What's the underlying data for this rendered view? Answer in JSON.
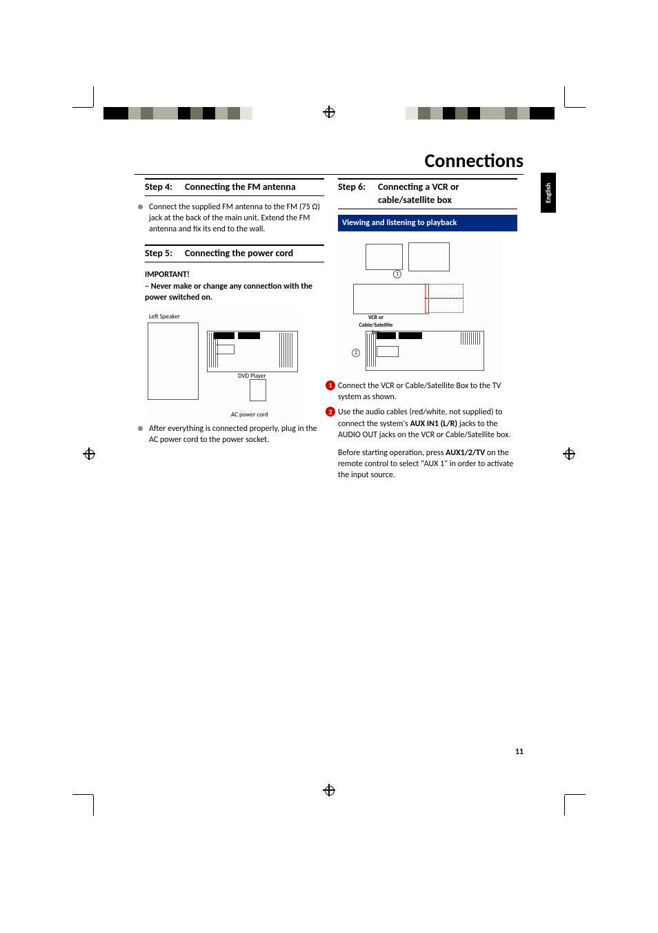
{
  "title": "Connections",
  "language_tab": "English",
  "page_number": "11",
  "left": {
    "step4": {
      "label": "Step 4:",
      "title": "Connecting the FM antenna"
    },
    "step4_body": "Connect the supplied FM antenna to the FM (75 Ω) jack at the back of the main unit. Extend the FM antenna and fix its end to the wall.",
    "step5": {
      "label": "Step 5:",
      "title": "Connecting the power cord"
    },
    "important_head": "IMPORTANT!",
    "important_body": "–   Never make or change any connection with the power switched on.",
    "diag": {
      "left_speaker": "Left Speaker",
      "dvd_player": "DVD Player",
      "ac_cord": "AC power cord"
    },
    "after_text": "After everything is connected properly, plug in the AC power cord to the power socket."
  },
  "right": {
    "step6": {
      "label": "Step 6:",
      "title": "Connecting a VCR or cable/satellite box"
    },
    "blue": "Viewing and listening to playback",
    "diag": {
      "vcr_label": "VCR or Cable/Satellite Box",
      "c1": "1",
      "c2": "2"
    },
    "n1": "Connect the VCR or Cable/Satellite Box to the TV system as shown.",
    "n2_pre": "Use the audio cables (red/white, not supplied) to connect the system's ",
    "n2_bold": "AUX IN1 (L/R)",
    "n2_post": " jacks to the AUDIO OUT jacks on the VCR or Cable/Satellite box.",
    "final_pre": "Before starting operation, press ",
    "final_bold": "AUX1/2/TV",
    "final_post": " on the remote control to select \"AUX 1\" in order to activate the input source."
  },
  "strip_colors": [
    "#000000",
    "#000000",
    "#b0b0a0",
    "#707060",
    "#b0b0a0",
    "#b0b0a0",
    "#000000",
    "#707060",
    "#000000",
    "#b0b0a0",
    "#707060",
    "#e5e5dd",
    "#ffffff",
    "#ffffff",
    "#ffffff"
  ]
}
